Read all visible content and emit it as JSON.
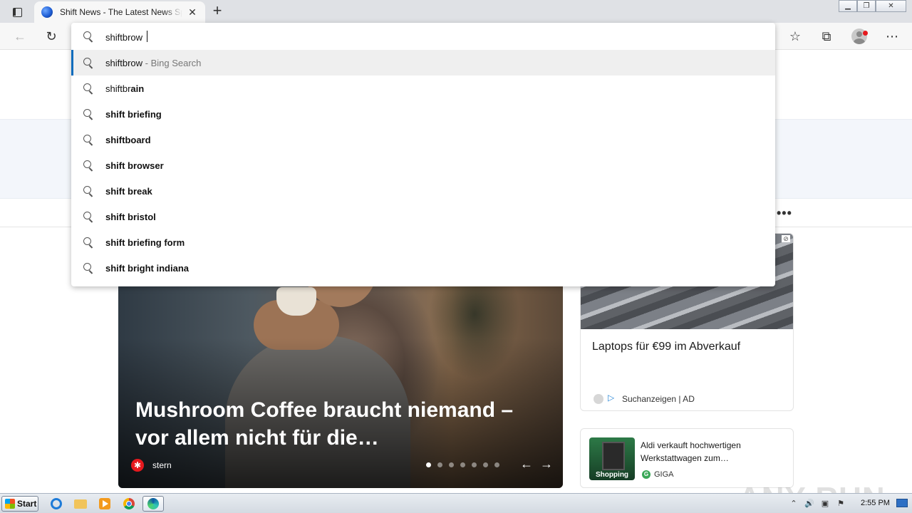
{
  "tab": {
    "title": "Shift News - The Latest News Sports",
    "close": "✕"
  },
  "toolbar": {
    "back": "←",
    "reload": "↻",
    "favorites": "☆",
    "collections": "⧉",
    "menu": "⋯"
  },
  "omnibox": {
    "value": "shiftbrow",
    "suggestions": [
      {
        "typed": "shiftbrow",
        "completion": "",
        "sub": " - Bing Search",
        "selected": true
      },
      {
        "typed": "shiftbr",
        "completion": "ain",
        "sub": ""
      },
      {
        "typed": "",
        "completion": "shift briefing",
        "sub": ""
      },
      {
        "typed": "",
        "completion": "shiftboard",
        "sub": ""
      },
      {
        "typed": "",
        "completion": "shift browser",
        "sub": ""
      },
      {
        "typed": "",
        "completion": "shift break",
        "sub": ""
      },
      {
        "typed": "",
        "completion": "shift bristol",
        "sub": ""
      },
      {
        "typed": "",
        "completion": "shift briefing form",
        "sub": ""
      },
      {
        "typed": "",
        "completion": "shift bright indiana",
        "sub": ""
      }
    ]
  },
  "page": {
    "more_dots": "•••",
    "hero": {
      "title": "Mushroom Coffee braucht niemand – vor allem nicht für die…",
      "source_icon": "✱",
      "source": "stern",
      "dots_total": 7,
      "dot_active": 1,
      "prev": "←",
      "next": "→"
    },
    "card1": {
      "ad_mark": "⊘",
      "title": "Laptops für €99 im Abverkauf",
      "play_icon": "▷",
      "source": "Suchanzeigen | AD"
    },
    "card2": {
      "badge": "Shopping",
      "title": "Aldi verkauft hochwertigen Werkstattwagen zum…",
      "source_icon": "G",
      "source": "GIGA"
    },
    "watermark": "ANY RUN"
  },
  "taskbar": {
    "start": "Start",
    "clock": "2:55 PM",
    "tray": [
      "⌃",
      "🔊",
      "▣",
      "⚑"
    ]
  },
  "colors": {
    "accent": "#0f6cbd",
    "selected_row": "#efefef",
    "stern_red": "#e5191e",
    "tab_bar": "#dfe1e5"
  }
}
